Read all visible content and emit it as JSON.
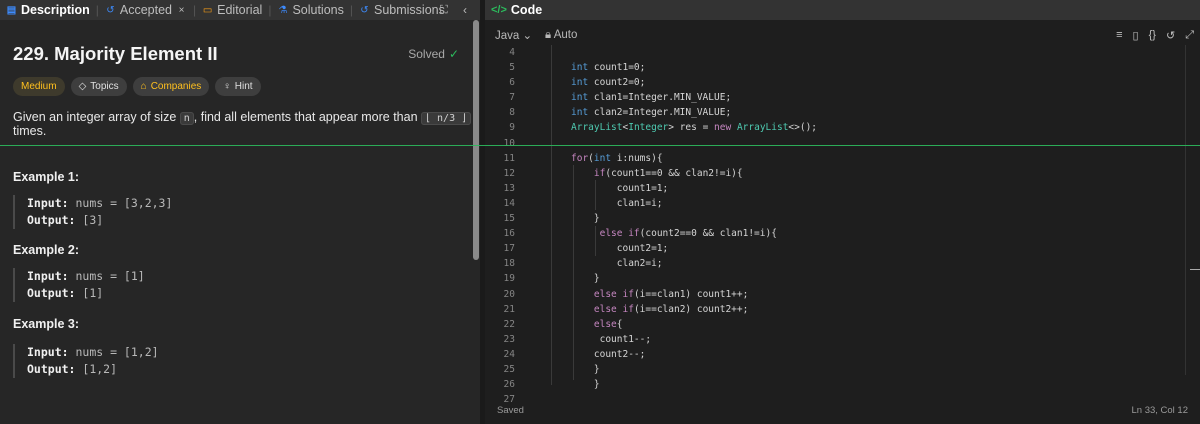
{
  "left_tabs": [
    {
      "label": "Description",
      "icon": "description-icon"
    },
    {
      "label": "Accepted",
      "icon": "history-icon"
    },
    {
      "label": "Editorial",
      "icon": "book-icon"
    },
    {
      "label": "Solutions",
      "icon": "flask-icon"
    },
    {
      "label": "Submissions",
      "icon": "history-icon"
    }
  ],
  "problem": {
    "title": "229. Majority Element II",
    "status": "Solved",
    "chips": {
      "difficulty": "Medium",
      "topics": "Topics",
      "companies": "Companies",
      "hint": "Hint"
    },
    "desc_before": "Given an integer array of size ",
    "desc_n": "n",
    "desc_middle": ", find all elements that appear more than ",
    "desc_frac": "⌊ n/3 ⌋",
    "desc_after": " times."
  },
  "examples": [
    {
      "title": "Example 1:",
      "input_label": "Input:",
      "input": " nums = [3,2,3]",
      "output_label": "Output:",
      "output": " [3]"
    },
    {
      "title": "Example 2:",
      "input_label": "Input:",
      "input": " nums = [1]",
      "output_label": "Output:",
      "output": " [1]"
    },
    {
      "title": "Example 3:",
      "input_label": "Input:",
      "input": " nums = [1,2]",
      "output_label": "Output:",
      "output": " [1,2]"
    }
  ],
  "code_panel": {
    "title": "Code",
    "language": "Java",
    "mode": "Auto",
    "status": "Saved",
    "cursor": "Ln 33, Col 12"
  },
  "line_numbers": [
    "4",
    "5",
    "6",
    "7",
    "8",
    "9",
    "10",
    "11",
    "12",
    "13",
    "14",
    "15",
    "16",
    "17",
    "18",
    "19",
    "20",
    "21",
    "22",
    "23",
    "24",
    "25",
    "26",
    "27"
  ],
  "colors": {
    "accent_green": "#2cbb5d",
    "medium_yellow": "#ffc01e",
    "blue": "#3d8bfd"
  }
}
